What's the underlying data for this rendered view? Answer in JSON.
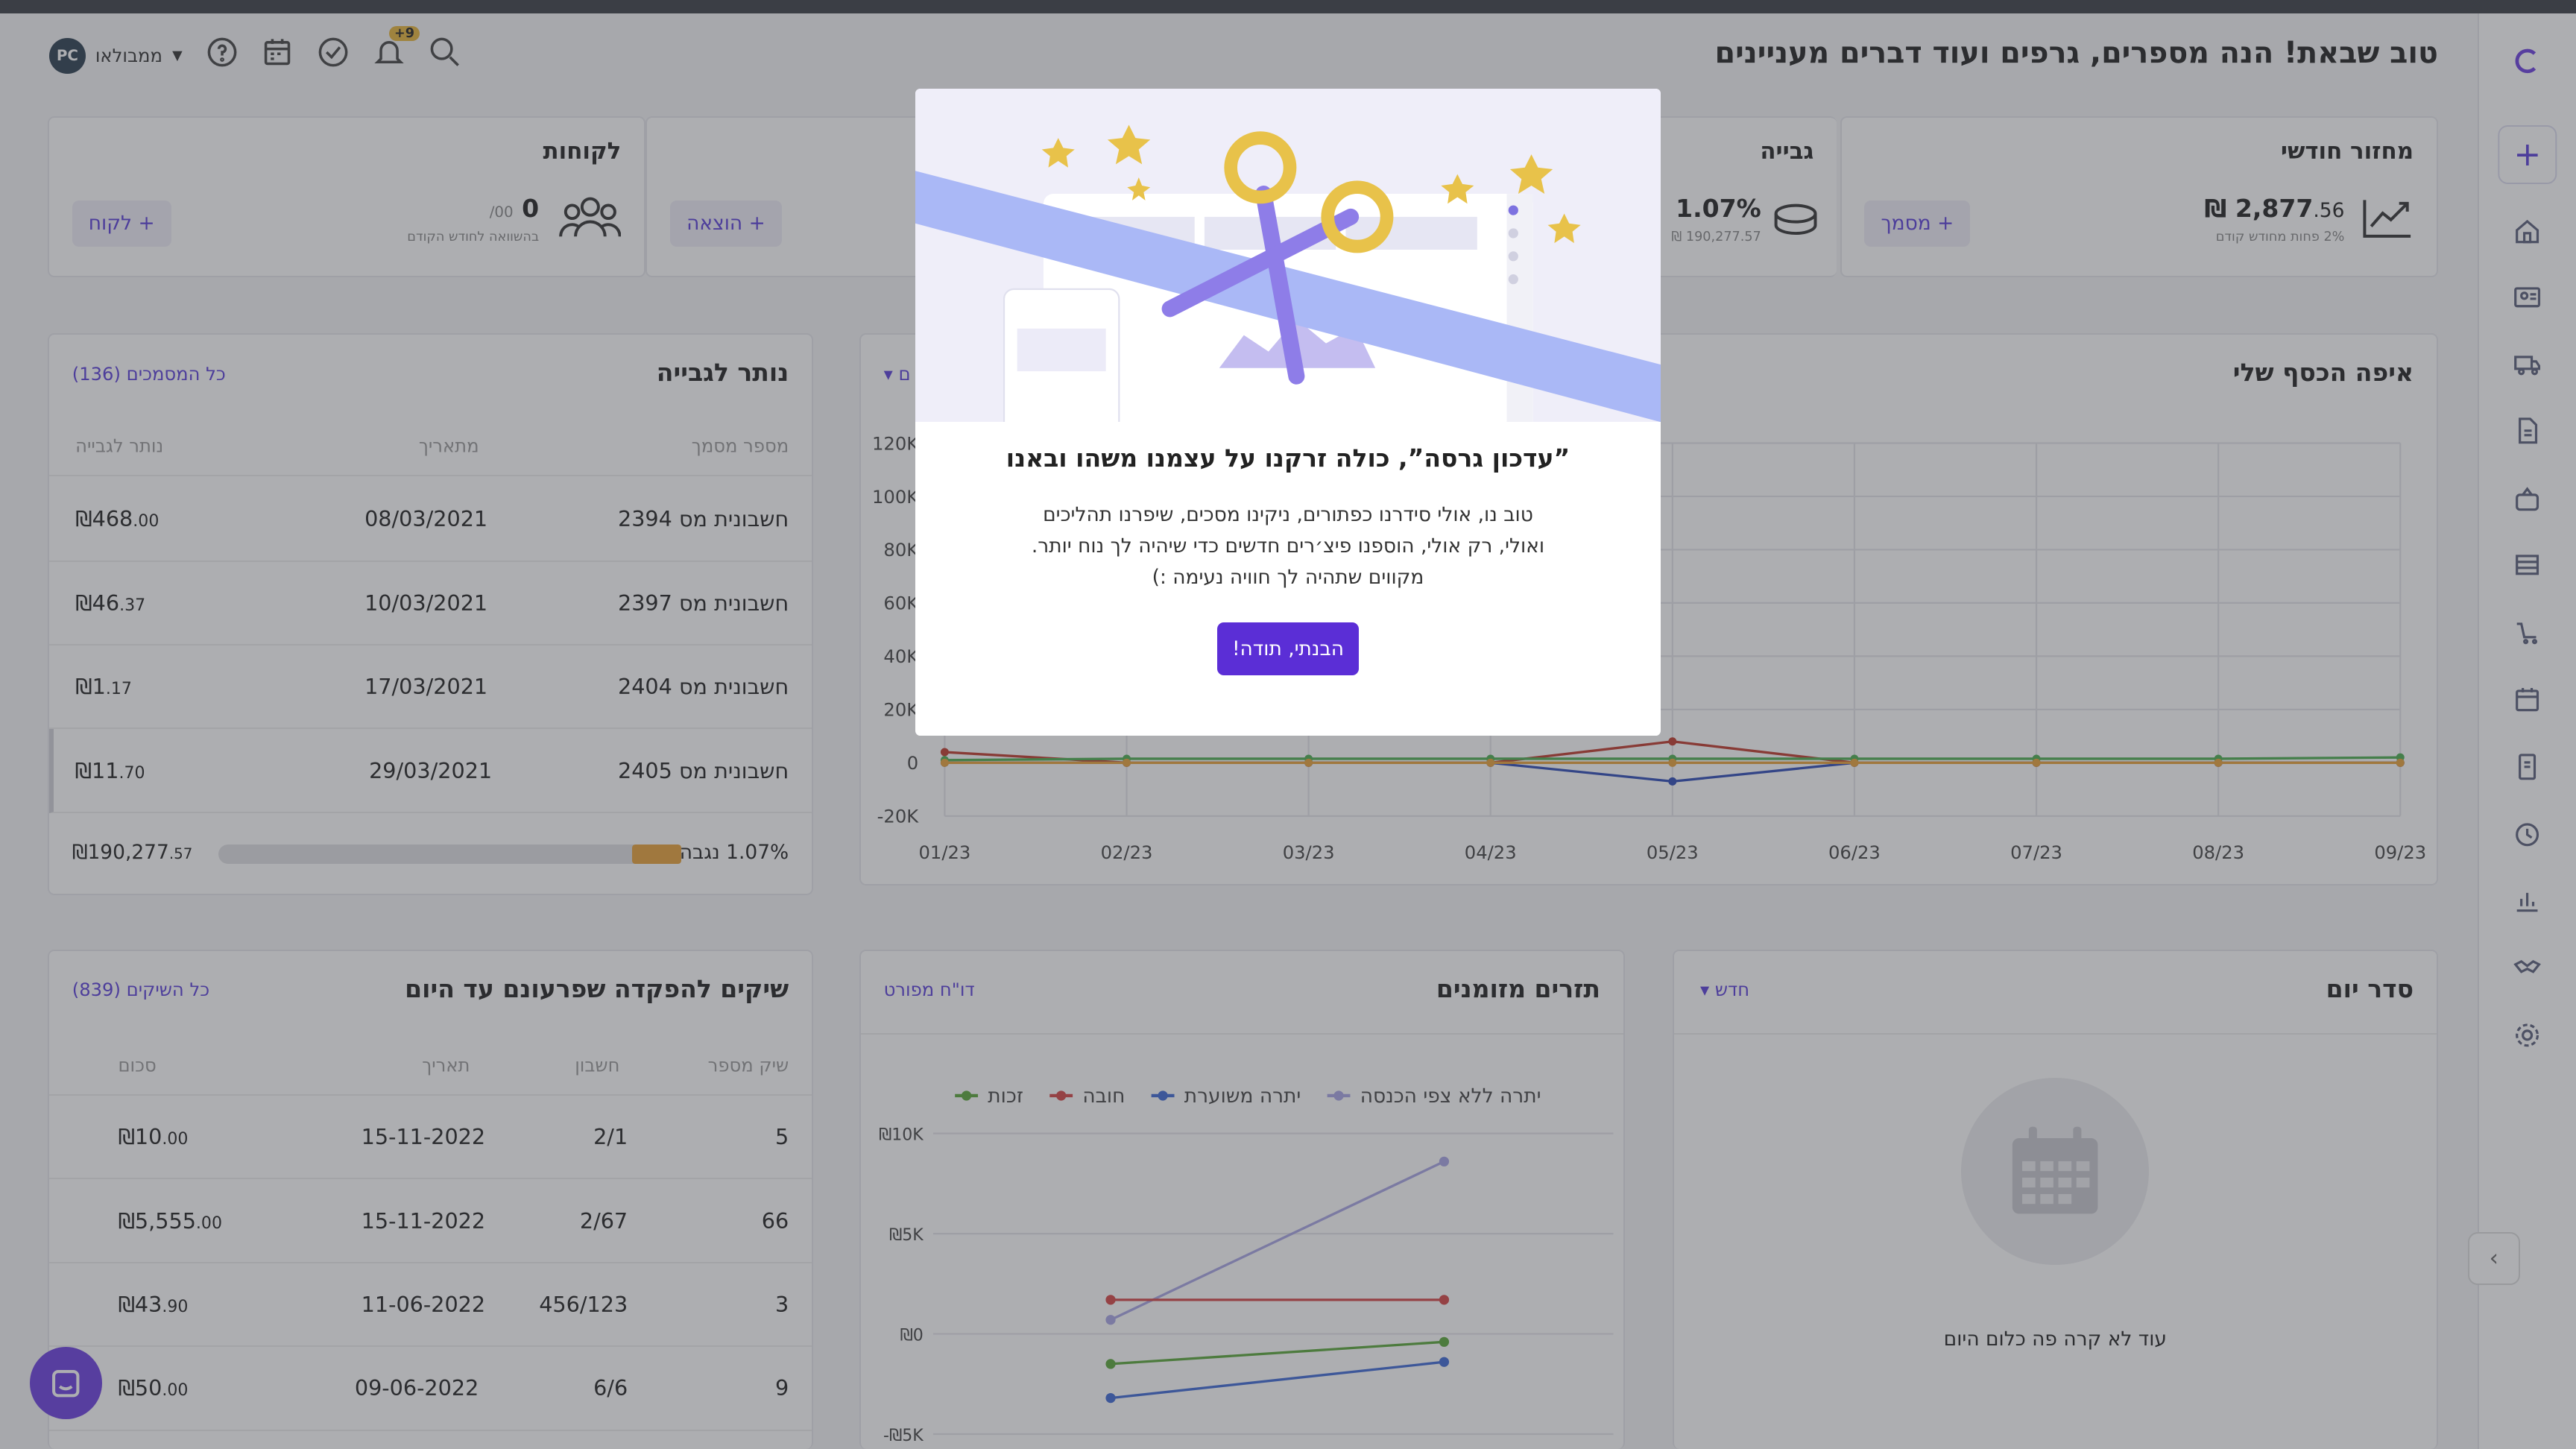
{
  "header": {
    "title": "טוב שבאת! הנה מספרים, גרפים ועוד דברים מעניינים",
    "user_name": "ממבולאו",
    "avatar_initials": "PC",
    "notif_count": "+9"
  },
  "kpis": {
    "revenue": {
      "title": "מחזור חודשי",
      "value_main": "₪ 2,877",
      "value_dec": ".56",
      "sub": "2% פחות מחודש קודם",
      "btn": "+ מסמך"
    },
    "collection": {
      "title": "גבייה",
      "value": "1.07%",
      "sub": "190,277.57 ₪"
    },
    "expense": {
      "btn": "+ הוצאה"
    },
    "customers": {
      "title": "לקוחות",
      "value": "0",
      "value_small": "/00",
      "sub": "בהשוואה לחודש הקודם",
      "btn": "+ לקוח"
    }
  },
  "remaining": {
    "title": "נותר לגבייה",
    "link": "כל המסמכים (136)",
    "cols": [
      "מספר מסמך",
      "מתאריך",
      "נותר לגבייה"
    ],
    "rows": [
      {
        "doc": "חשבונית מס 2394",
        "date": "08/03/2021",
        "amount": "₪468",
        "dec": ".00"
      },
      {
        "doc": "חשבונית מס 2397",
        "date": "10/03/2021",
        "amount": "₪46",
        "dec": ".37"
      },
      {
        "doc": "חשבונית מס 2404",
        "date": "17/03/2021",
        "amount": "₪1",
        "dec": ".17"
      },
      {
        "doc": "חשבונית מס 2405",
        "date": "29/03/2021",
        "amount": "₪11",
        "dec": ".70"
      }
    ],
    "footer_pct": "1.07% נגבה",
    "footer_total": "₪190,277",
    "footer_dec": ".57",
    "collected_fraction": 0.0107
  },
  "money": {
    "title": "איפה הכסף שלי",
    "filter": "ם"
  },
  "checks": {
    "title": "שיקים להפקדה שפרעונם עד היום",
    "link": "כל השיקים (839)",
    "cols": [
      "שיק מספר",
      "חשבון",
      "תאריך",
      "סכום"
    ],
    "rows": [
      {
        "num": "5",
        "acct": "2/1",
        "date": "15-11-2022",
        "amount": "₪10",
        "dec": ".00"
      },
      {
        "num": "66",
        "acct": "2/67",
        "date": "15-11-2022",
        "amount": "₪5,555",
        "dec": ".00"
      },
      {
        "num": "3",
        "acct": "456/123",
        "date": "11-06-2022",
        "amount": "₪43",
        "dec": ".90"
      },
      {
        "num": "9",
        "acct": "6/6",
        "date": "09-06-2022",
        "amount": "₪50",
        "dec": ".00"
      }
    ]
  },
  "flows": {
    "title": "תזרים מזומנים",
    "link": "דו\"ח מפורט"
  },
  "agenda": {
    "title": "סדר יום",
    "filter": "חדש",
    "empty": "עוד לא קרה פה כלום היום"
  },
  "modal": {
    "title": "”עדכון גרסה”, כולה זרקנו על עצמנו משהו ובאנו",
    "line1": "טוב נו, אולי סידרנו כפתורים, ניקינו מסכים, שיפרנו תהליכים",
    "line2": "ואולי, רק אולי, הוספנו פיצ׳רים חדשים כדי שיהיה לך נוח יותר.",
    "line3": "מקווים שתהיה לך חוויה נעימה :)",
    "button": "הבנתי, תודה!"
  },
  "chart_data": [
    {
      "type": "line",
      "title": "איפה הכסף שלי",
      "x": [
        "01/23",
        "02/23",
        "03/23",
        "04/23",
        "05/23",
        "06/23",
        "07/23",
        "08/23",
        "09/23"
      ],
      "ylim": [
        -20000,
        120000
      ],
      "yticks": [
        "120K",
        "100K",
        "80K",
        "60K",
        "40K",
        "20K",
        "0",
        "-20K"
      ],
      "series": [
        {
          "color": "#c0392b",
          "values": [
            4000,
            0,
            0,
            0,
            8000,
            0,
            0,
            0,
            0
          ]
        },
        {
          "color": "#2e4bb7",
          "values": [
            0,
            0,
            0,
            0,
            -7000,
            0,
            0,
            0,
            0
          ]
        },
        {
          "color": "#4caf50",
          "values": [
            1000,
            1500,
            1500,
            1500,
            1500,
            1500,
            1500,
            1500,
            2000
          ]
        },
        {
          "color": "#e8a33a",
          "values": [
            0,
            0,
            0,
            0,
            0,
            0,
            0,
            0,
            0
          ]
        }
      ]
    },
    {
      "type": "line",
      "title": "תזרים מזומנים",
      "yticks": [
        "₪10K",
        "₪5K",
        "₪0",
        "-₪5K"
      ],
      "ylim": [
        -5000,
        10000
      ],
      "series": [
        {
          "name": "יתרה ללא צפי הכנסה",
          "color": "#a9a6e6",
          "values": [
            700,
            8600
          ]
        },
        {
          "name": "יתרה משוערת",
          "color": "#3e6ad6",
          "values": [
            -3200,
            -1400
          ]
        },
        {
          "name": "חובה",
          "color": "#d64545",
          "values": [
            1700,
            1700
          ]
        },
        {
          "name": "זכות",
          "color": "#5aa83a",
          "values": [
            -1500,
            -400
          ]
        }
      ]
    }
  ]
}
